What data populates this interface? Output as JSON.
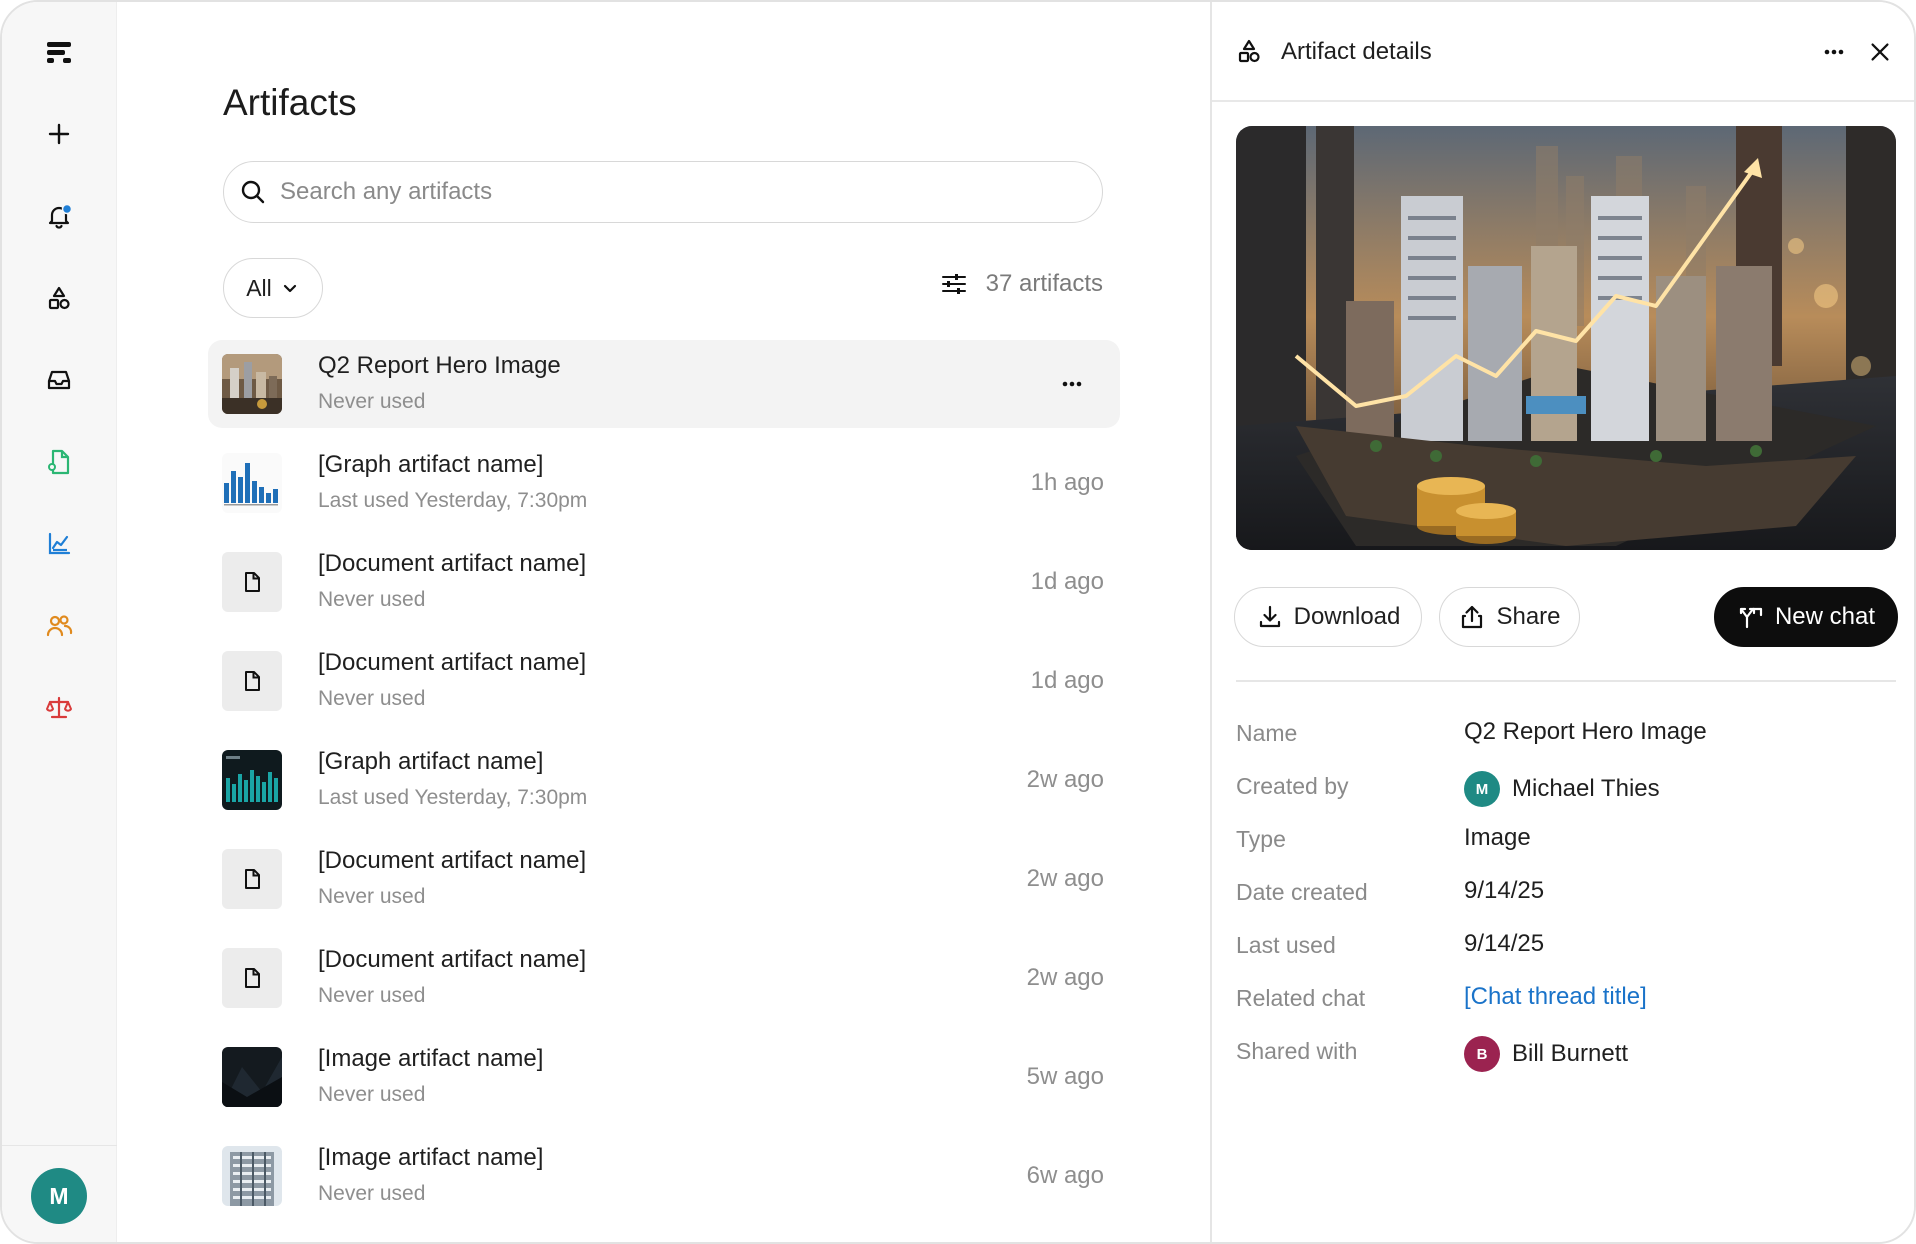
{
  "rail": {
    "user_initial": "M",
    "colors": {
      "green": "#2bb673",
      "blue": "#1f7fd6",
      "orange": "#e08a1e",
      "red": "#d93b3b",
      "notify_dot": "#1f7fd6"
    }
  },
  "main": {
    "title": "Artifacts",
    "search_placeholder": "Search any artifacts",
    "filter_label": "All",
    "count_label": "37 artifacts",
    "items": [
      {
        "title": "Q2 Report Hero Image",
        "sub": "Never used",
        "time": "",
        "thumb": "photo",
        "selected": true
      },
      {
        "title": "[Graph artifact name]",
        "sub": "Last used Yesterday, 7:30pm",
        "time": "1h ago",
        "thumb": "graph-light"
      },
      {
        "title": "[Document artifact name]",
        "sub": "Never used",
        "time": "1d ago",
        "thumb": "doc"
      },
      {
        "title": "[Document artifact name]",
        "sub": "Never used",
        "time": "1d ago",
        "thumb": "doc"
      },
      {
        "title": "[Graph artifact name]",
        "sub": "Last used Yesterday, 7:30pm",
        "time": "2w ago",
        "thumb": "graph-dark"
      },
      {
        "title": "[Document artifact name]",
        "sub": "Never used",
        "time": "2w ago",
        "thumb": "doc"
      },
      {
        "title": "[Document artifact name]",
        "sub": "Never used",
        "time": "2w ago",
        "thumb": "doc"
      },
      {
        "title": "[Image artifact name]",
        "sub": "Never used",
        "time": "5w ago",
        "thumb": "dark-image"
      },
      {
        "title": "[Image artifact name]",
        "sub": "Never used",
        "time": "6w ago",
        "thumb": "building"
      }
    ]
  },
  "panel": {
    "title": "Artifact details",
    "buttons": {
      "download": "Download",
      "share": "Share",
      "new_chat": "New chat"
    },
    "details": {
      "name_label": "Name",
      "name_value": "Q2 Report Hero Image",
      "created_label": "Created by",
      "created_value": "Michael Thies",
      "created_initial": "M",
      "created_color": "#1f8a84",
      "type_label": "Type",
      "type_value": "Image",
      "date_label": "Date created",
      "date_value": "9/14/25",
      "last_label": "Last used",
      "last_value": "9/14/25",
      "chat_label": "Related chat",
      "chat_value": "[Chat thread title]",
      "shared_label": "Shared with",
      "shared_value": "Bill Burnett",
      "shared_initial": "B",
      "shared_color": "#9b2350"
    }
  }
}
